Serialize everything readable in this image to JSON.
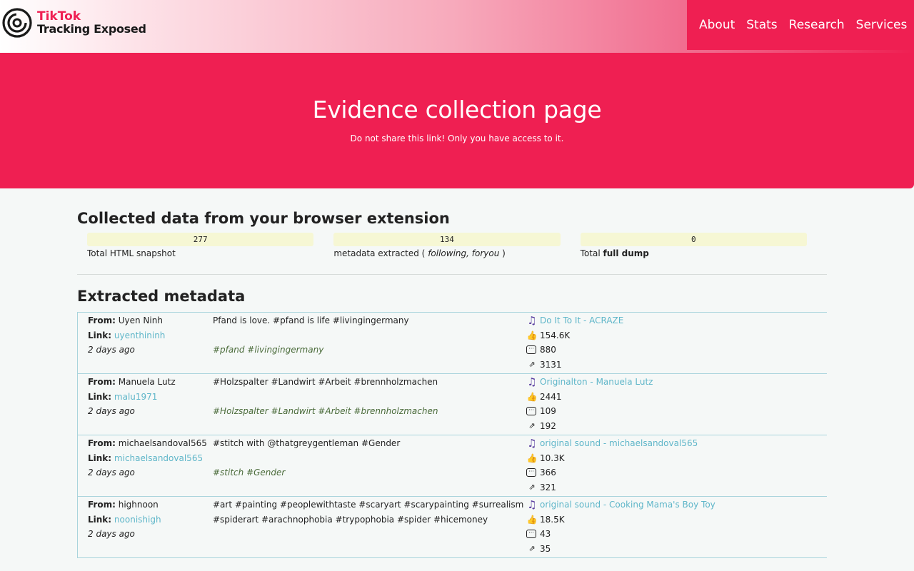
{
  "nav": {
    "logo_line1": "TikTok",
    "logo_line2": "Tracking Exposed",
    "links": [
      "About",
      "Stats",
      "Research",
      "Services"
    ]
  },
  "hero": {
    "title": "Evidence collection page",
    "subtitle": "Do not share this link! Only you have access to it."
  },
  "collected": {
    "title": "Collected data from your browser extension",
    "stats": [
      {
        "value": "277",
        "label_prefix": "Total HTML snapshot"
      },
      {
        "value": "134",
        "label_prefix": "metadata extracted ( ",
        "label_em": "following, foryou",
        "label_suffix": " )"
      },
      {
        "value": "0",
        "label_prefix": "Total ",
        "label_strong": "full dump"
      }
    ]
  },
  "metadata": {
    "title": "Extracted metadata",
    "from_label": "From:",
    "link_label": "Link:",
    "entries": [
      {
        "from": "Uyen Ninh",
        "link": "uyenthininh",
        "ago": "2 days ago",
        "desc": "Pfand is love. #pfand is life #livingingermany",
        "tags": "#pfand #livingingermany",
        "music": "Do It To It - ACRAZE",
        "likes": "154.6K",
        "comments": "880",
        "shares": "3131"
      },
      {
        "from": "Manuela Lutz",
        "link": "malu1971",
        "ago": "2 days ago",
        "desc": "#Holzspalter #Landwirt #Arbeit #brennholzmachen",
        "tags": "#Holzspalter #Landwirt #Arbeit #brennholzmachen",
        "music": "Originalton - Manuela Lutz",
        "likes": "2441",
        "comments": "109",
        "shares": "192"
      },
      {
        "from": "michaelsandoval565",
        "link": "michaelsandoval565",
        "ago": "2 days ago",
        "desc": "#stitch with @thatgreygentleman #Gender",
        "tags": "#stitch #Gender",
        "music": "original sound - michaelsandoval565",
        "likes": "10.3K",
        "comments": "366",
        "shares": "321"
      },
      {
        "from": "highnoon",
        "link": "noonishigh",
        "ago": "2 days ago",
        "desc": "#art #painting #peoplewithtaste #scaryart #scarypainting #surrealism #spiderart #arachnophobia #trypophobia #spider #hicemoney",
        "tags": "",
        "music": "original sound - Cooking Mama's Boy Toy",
        "likes": "18.5K",
        "comments": "43",
        "shares": "35"
      }
    ]
  },
  "icons": {
    "music": "music-note-icon",
    "likes": "thumbs-up-icon",
    "comments": "speech-bubble-icon",
    "shares": "share-arrow-icon"
  },
  "colors": {
    "brand": "#ef1f52",
    "link": "#5fb6c9",
    "stat_bg": "#f6f7d4"
  }
}
